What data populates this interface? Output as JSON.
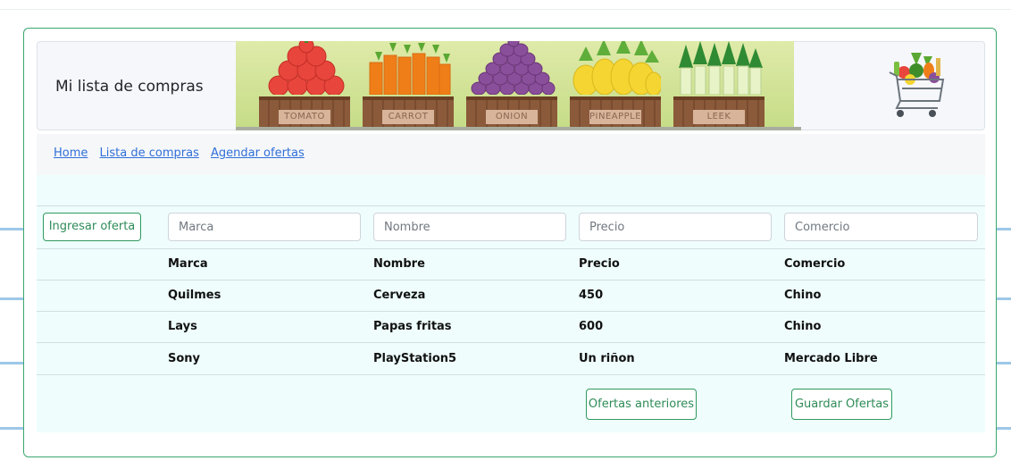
{
  "header": {
    "title": "Mi lista de compras",
    "crates": [
      {
        "label": "TOMATO",
        "produce": "tomato"
      },
      {
        "label": "CARROT",
        "produce": "carrot"
      },
      {
        "label": "ONION",
        "produce": "onion"
      },
      {
        "label": "PINEAPPLE",
        "produce": "pineapple"
      },
      {
        "label": "LEEK",
        "produce": "leek"
      }
    ],
    "logo_icon": "shopping-cart-with-vegetables-icon"
  },
  "nav": {
    "links": [
      "Home",
      "Lista de compras",
      "Agendar ofertas"
    ]
  },
  "form": {
    "add_button": "Ingresar oferta",
    "placeholders": {
      "marca": "Marca",
      "nombre": "Nombre",
      "precio": "Precio",
      "comercio": "Comercio"
    }
  },
  "table": {
    "headers": [
      "Marca",
      "Nombre",
      "Precio",
      "Comercio"
    ],
    "rows": [
      [
        "Quilmes",
        "Cerveza",
        "450",
        "Chino"
      ],
      [
        "Lays",
        "Papas fritas",
        "600",
        "Chino"
      ],
      [
        "Sony",
        "PlayStation5",
        "Un riñon",
        "Mercado Libre"
      ]
    ]
  },
  "actions": {
    "previous": "Ofertas anteriores",
    "save": "Guardar Ofertas"
  },
  "colors": {
    "accent_green": "#2e9a5e",
    "link_blue": "#2f6fd8",
    "main_bg": "#effdfd"
  }
}
